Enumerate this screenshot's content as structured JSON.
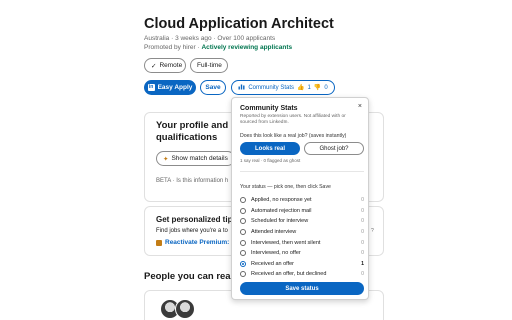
{
  "job": {
    "title": "Cloud Application Architect",
    "meta": "Australia · 3 weeks ago · Over 100 applicants",
    "promoted_prefix": "Promoted by hirer · ",
    "active_status": "Actively reviewing applicants",
    "tags": [
      "Remote",
      "Full-time"
    ]
  },
  "actions": {
    "easy_apply": "Easy Apply",
    "save": "Save",
    "community_stats": "Community Stats",
    "thumbs_up_count": "1",
    "thumbs_down_count": "0"
  },
  "profile_card": {
    "heading": "Your profile and res",
    "heading_line2": "qualifications",
    "show_match": "Show match details",
    "beta": "BETA · Is this information h"
  },
  "tips_card": {
    "heading": "Get personalized tips to",
    "text": "Find jobs where you're a to",
    "link": "Reactivate Premium: 5"
  },
  "people": {
    "heading": "People you can reach"
  },
  "popup": {
    "title": "Community Stats",
    "close": "×",
    "subtitle": "Reported by extension users. Not affiliated with or sourced from LinkedIn.",
    "question": "Does this look like a real job? (saves instantly)",
    "looks_real": "Looks real",
    "ghost_job": "Ghost job?",
    "counts": "1 say real · 0 flagged as ghost",
    "status_prompt": "Your status — pick one, then click Save",
    "statuses": [
      {
        "label": "Applied, no response yet",
        "count": "0",
        "checked": false
      },
      {
        "label": "Automated rejection mail",
        "count": "0",
        "checked": false
      },
      {
        "label": "Scheduled for interview",
        "count": "0",
        "checked": false
      },
      {
        "label": "Attended interview",
        "count": "0",
        "checked": false
      },
      {
        "label": "Interviewed, then went silent",
        "count": "0",
        "checked": false
      },
      {
        "label": "Interviewed, no offer",
        "count": "0",
        "checked": false
      },
      {
        "label": "Received an offer",
        "count": "1",
        "checked": true
      },
      {
        "label": "Received an offer, but declined",
        "count": "0",
        "checked": false
      }
    ],
    "save_status": "Save status"
  },
  "side_marker": "?",
  "colors": {
    "primary": "#0a66c2",
    "active_green": "#01754f",
    "premium": "#c37d16"
  }
}
